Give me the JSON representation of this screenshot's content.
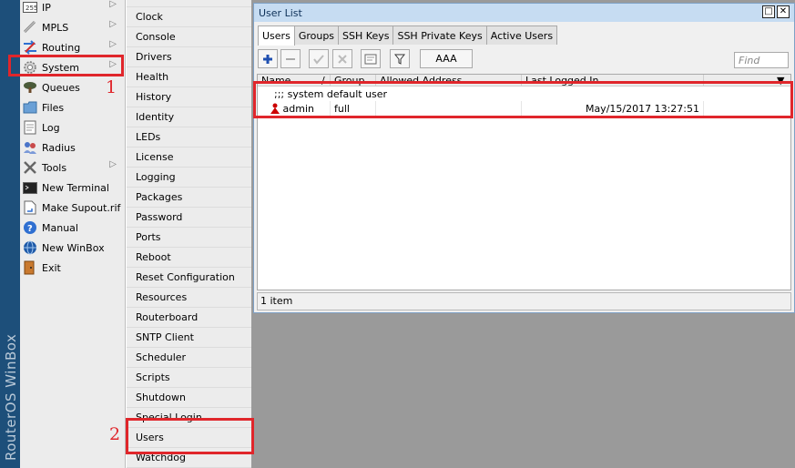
{
  "brand": {
    "text": "RouterOS WinBox",
    "strip_color": "#1d4f7a"
  },
  "main_menu": {
    "items": [
      {
        "label": "IP",
        "icon": "ip-icon",
        "has_submenu": true
      },
      {
        "label": "MPLS",
        "icon": "mpls-icon",
        "has_submenu": true
      },
      {
        "label": "Routing",
        "icon": "routing-icon",
        "has_submenu": true
      },
      {
        "label": "System",
        "icon": "gear-icon",
        "has_submenu": true
      },
      {
        "label": "Queues",
        "icon": "queues-icon",
        "has_submenu": false
      },
      {
        "label": "Files",
        "icon": "folder-icon",
        "has_submenu": false
      },
      {
        "label": "Log",
        "icon": "log-icon",
        "has_submenu": false
      },
      {
        "label": "Radius",
        "icon": "radius-icon",
        "has_submenu": false
      },
      {
        "label": "Tools",
        "icon": "tools-icon",
        "has_submenu": true
      },
      {
        "label": "New Terminal",
        "icon": "terminal-icon",
        "has_submenu": false
      },
      {
        "label": "Make Supout.rif",
        "icon": "supout-icon",
        "has_submenu": false
      },
      {
        "label": "Manual",
        "icon": "manual-icon",
        "has_submenu": false
      },
      {
        "label": "New WinBox",
        "icon": "winbox-icon",
        "has_submenu": false
      },
      {
        "label": "Exit",
        "icon": "exit-icon",
        "has_submenu": false
      }
    ]
  },
  "submenu": {
    "items": [
      "Clock",
      "Console",
      "Drivers",
      "Health",
      "History",
      "Identity",
      "LEDs",
      "License",
      "Logging",
      "Packages",
      "Password",
      "Ports",
      "Reboot",
      "Reset Configuration",
      "Resources",
      "Routerboard",
      "SNTP Client",
      "Scheduler",
      "Scripts",
      "Shutdown",
      "Special Login",
      "Users",
      "Watchdog"
    ]
  },
  "annotations": {
    "label_1": "1",
    "label_2": "2",
    "color": "#e0262b"
  },
  "window": {
    "title": "User List",
    "tabs": [
      "Users",
      "Groups",
      "SSH Keys",
      "SSH Private Keys",
      "Active Users"
    ],
    "active_tab": "Users",
    "toolbar": {
      "aaa_label": "AAA",
      "find_placeholder": "Find"
    },
    "columns": [
      "Name",
      "Group",
      "Allowed Address",
      "Last Logged In"
    ],
    "sort_indicator": "/",
    "comment_row": ";;; system default user",
    "rows": [
      {
        "name": "admin",
        "group": "full",
        "allowed_address": "",
        "last_logged_in": "May/15/2017 13:27:51"
      }
    ],
    "status": "1 item"
  }
}
